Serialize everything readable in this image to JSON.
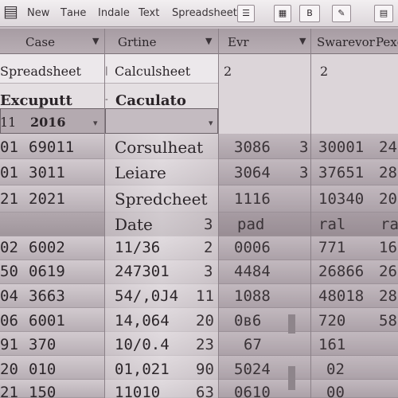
{
  "menu": {
    "items": [
      "New",
      "Tане",
      "Indale",
      "Text",
      "Spreadsheet"
    ],
    "btn_b": "B"
  },
  "header": {
    "col_a": "Case",
    "col_b": "Grtine",
    "col_c": "Evr",
    "col_d": "Swarevor",
    "col_e": "Pexe"
  },
  "tabrow": {
    "left": "Spreadsheet",
    "mid": "Calculsheet",
    "c": "2",
    "d": "2"
  },
  "editrow": {
    "left": "Excuputt",
    "mid": "Caculato",
    "sel_left": "11",
    "sel_val": "2016"
  },
  "rows": [
    {
      "a": "01",
      "b": "69011",
      "c": "Corsulheat",
      "d": "3086",
      "e": "3",
      "f": "30001",
      "g": "24"
    },
    {
      "a": "01",
      "b": "3011",
      "c": "Leiare",
      "d": "3064",
      "e": "3",
      "f": "37651",
      "g": "28"
    },
    {
      "a": "21",
      "b": "2021",
      "c": "Spredcheet",
      "d": "1116",
      "e": "",
      "f": "10340",
      "g": "20"
    },
    {
      "a": "",
      "b": "",
      "c": "Date",
      "cnum": "3",
      "d": "pad",
      "e": "",
      "f": "ral",
      "g": "ral"
    },
    {
      "a": "02",
      "b": "6002",
      "c": "11/36",
      "cnum": "2",
      "d": "0006",
      "e": "",
      "f": "771",
      "g": "16"
    },
    {
      "a": "50",
      "b": "0619",
      "c": "247301",
      "cnum": "3",
      "d": "4484",
      "e": "",
      "f": "26866",
      "g": "26"
    },
    {
      "a": "04",
      "b": "3663",
      "c": "54/,0J4",
      "cnum": "11",
      "d": "1088",
      "e": "",
      "f": "48018",
      "g": "28"
    },
    {
      "a": "06",
      "b": "6001",
      "c": "14,064",
      "cnum": "20",
      "d": "0в6",
      "e": "",
      "f": "720",
      "g": "58"
    },
    {
      "a": "91",
      "b": "370",
      "c": "10/0.4",
      "cnum": "23",
      "d": "67",
      "e": "",
      "f": "161",
      "g": ""
    },
    {
      "a": "20",
      "b": "010",
      "c": "01,021",
      "cnum": "90",
      "d": "5024",
      "e": "",
      "f": "02",
      "g": ""
    },
    {
      "a": "21",
      "b": "150",
      "c": "11010",
      "cnum": "63",
      "d": "0610",
      "e": "",
      "f": "00",
      "g": ""
    }
  ]
}
